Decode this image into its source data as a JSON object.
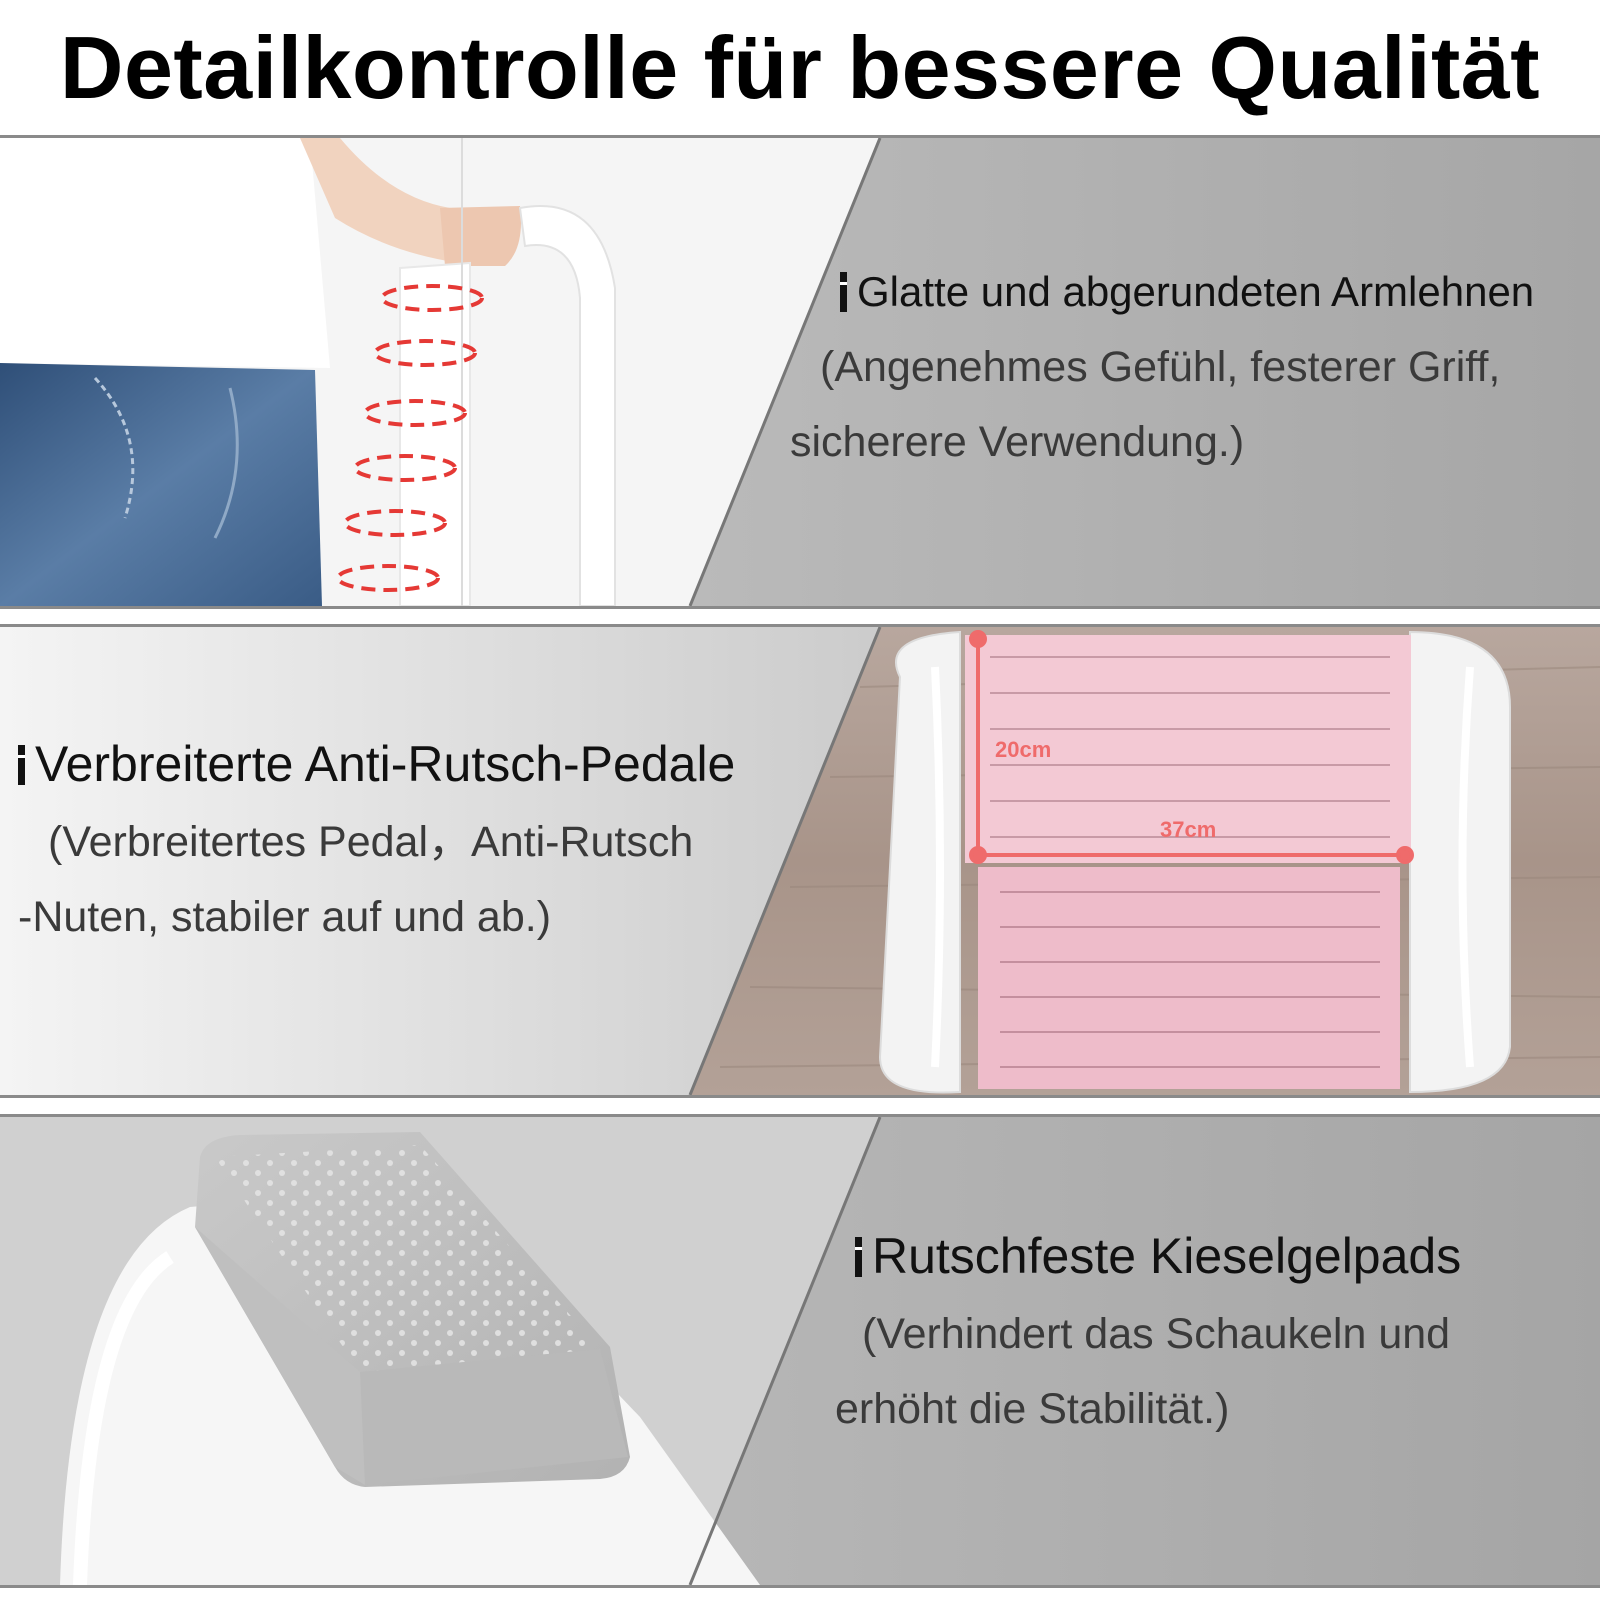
{
  "title": "Detailkontrolle für bessere Qualität",
  "sections": [
    {
      "heading": "Glatte und abgerundeten Armlehnen",
      "line1": "(Angenehmes Gefühl, festerer Griff,",
      "line2": "sicherere Verwendung.)"
    },
    {
      "heading": "Verbreiterte Anti-Rutsch-Pedale",
      "line1": "(Verbreitertes Pedal，Anti-Rutsch",
      "line2": "-Nuten, stabiler auf und ab.)",
      "dim_height": "20cm",
      "dim_width": "37cm"
    },
    {
      "heading": "Rutschfeste Kieselgelpads",
      "line1": "(Verhindert das Schaukeln und",
      "line2": "erhöht die Stabilität.)"
    }
  ],
  "colors": {
    "panel_gray": "#a9a9a9",
    "dash_red": "#e53935",
    "pedal_pink": "#f1c6d2",
    "dim_marker": "#ef6b6b"
  }
}
